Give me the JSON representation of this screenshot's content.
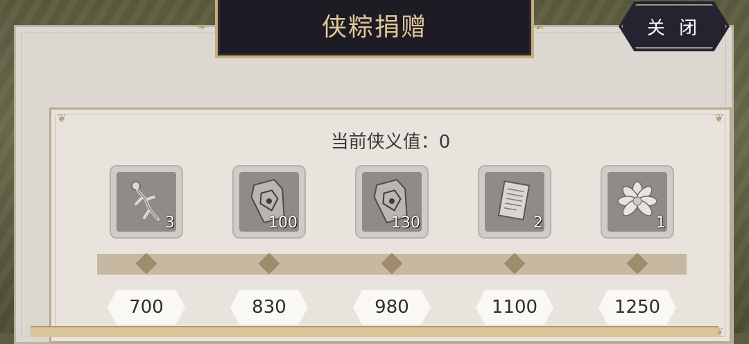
{
  "title": "侠粽捐赠",
  "close_label": "关 闭",
  "current_value_label": "当前侠义值：0",
  "rewards": [
    {
      "icon": "skeleton-figure-icon",
      "count": "3"
    },
    {
      "icon": "token-plaque-icon",
      "count": "100"
    },
    {
      "icon": "token-plaque-icon",
      "count": "130"
    },
    {
      "icon": "scroll-paper-icon",
      "count": "2"
    },
    {
      "icon": "lotus-flower-icon",
      "count": "1"
    }
  ],
  "thresholds": [
    "700",
    "830",
    "980",
    "1100",
    "1250"
  ],
  "progress": 0,
  "colors": {
    "panel": "#dcd7d1",
    "title_plaque": "#1d1c24",
    "title_text": "#e1c79a",
    "track": "#c6b8a1",
    "marker": "#9f8c6f"
  }
}
